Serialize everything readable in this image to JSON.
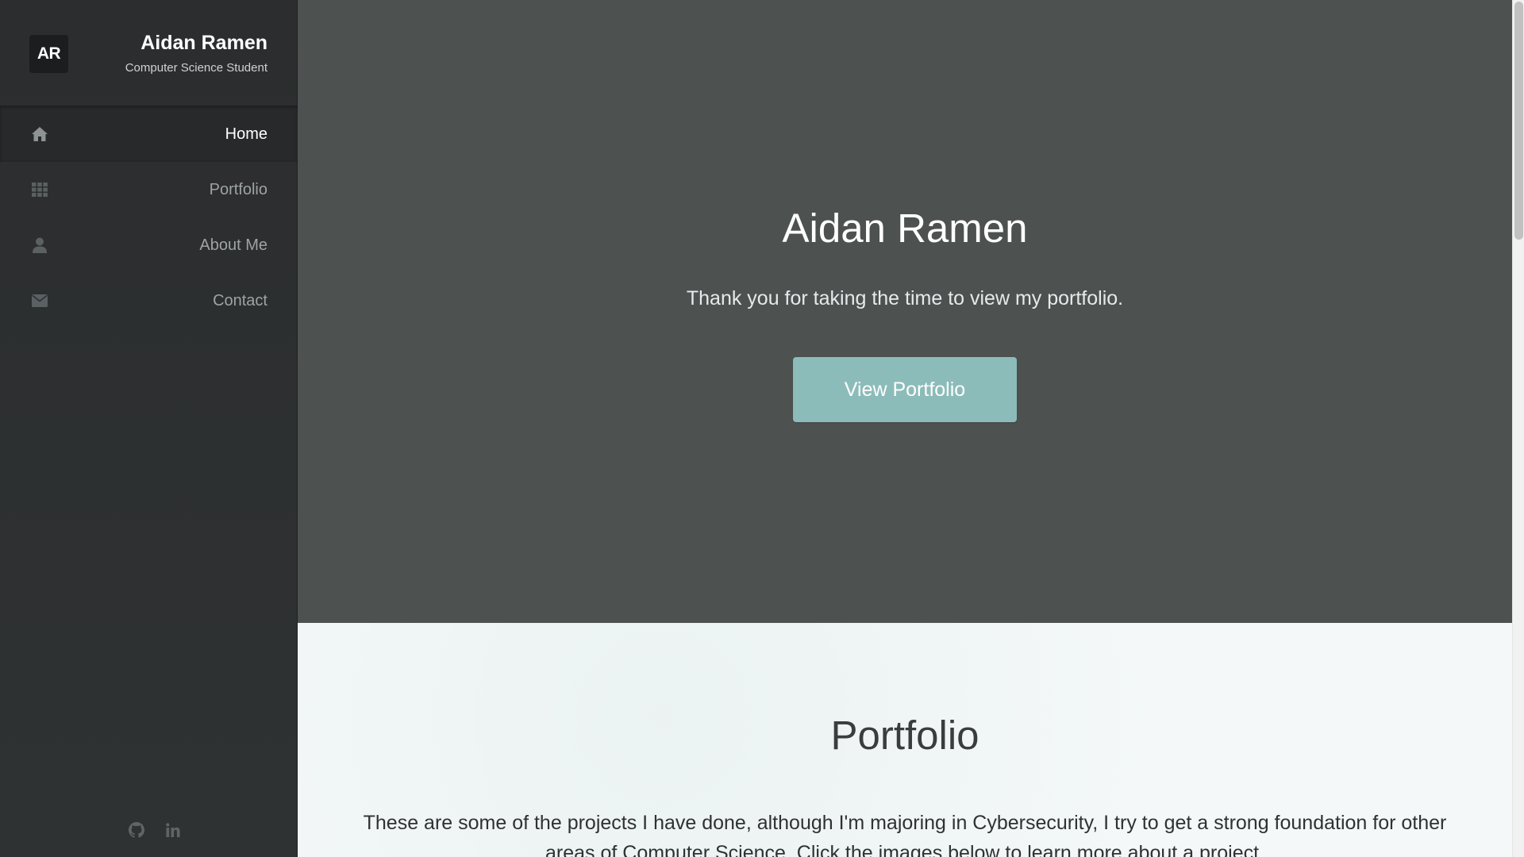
{
  "profile": {
    "logo_text": "AR",
    "name": "Aidan Ramen",
    "role": "Computer Science Student"
  },
  "nav": {
    "items": [
      {
        "label": "Home",
        "icon": "home-icon",
        "active": true
      },
      {
        "label": "Portfolio",
        "icon": "grid-icon",
        "active": false
      },
      {
        "label": "About Me",
        "icon": "user-icon",
        "active": false
      },
      {
        "label": "Contact",
        "icon": "envelope-icon",
        "active": false
      }
    ]
  },
  "social": {
    "items": [
      {
        "icon": "github-icon"
      },
      {
        "icon": "linkedin-icon"
      }
    ]
  },
  "hero": {
    "title": "Aidan Ramen",
    "subtitle": "Thank you for taking the time to view my portfolio.",
    "button_label": "View Portfolio"
  },
  "portfolio": {
    "title": "Portfolio",
    "text": "These are some of the projects I have done, although I'm majoring in Cybersecurity, I try to get a strong foundation for other areas of Computer Science. Click the images below to learn more about a project."
  },
  "colors": {
    "sidebar_bg": "#2b2d2e",
    "hero_bg": "#4d5251",
    "accent": "#8cbcb9",
    "portfolio_bg": "#f4f8f8"
  }
}
